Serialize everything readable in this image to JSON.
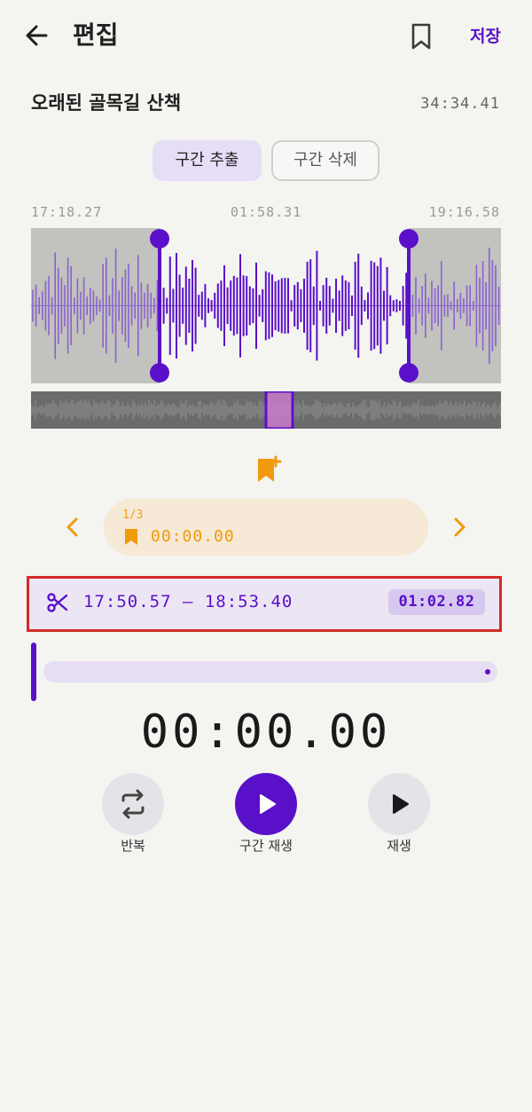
{
  "header": {
    "title": "편집",
    "save_label": "저장"
  },
  "recording": {
    "name": "오래된 골목길 산책",
    "total_duration": "34:34.41"
  },
  "modes": {
    "extract_label": "구간 추출",
    "delete_label": "구간 삭제",
    "selected": "구간 추출"
  },
  "timeline": {
    "left_time": "17:18.27",
    "center_time": "01:58.31",
    "right_time": "19:16.58"
  },
  "bookmark": {
    "counter": "1/3",
    "time": "00:00.00"
  },
  "selection": {
    "range": "17:50.57 – 18:53.40",
    "duration": "01:02.82"
  },
  "playback": {
    "current_time": "00:00.00",
    "progress": 0
  },
  "controls": {
    "repeat_label": "반복",
    "segment_play_label": "구간 재생",
    "play_label": "재생"
  },
  "colors": {
    "accent": "#5a10c9",
    "bookmark": "#f19a0c",
    "highlight_border": "#d42a2a"
  }
}
